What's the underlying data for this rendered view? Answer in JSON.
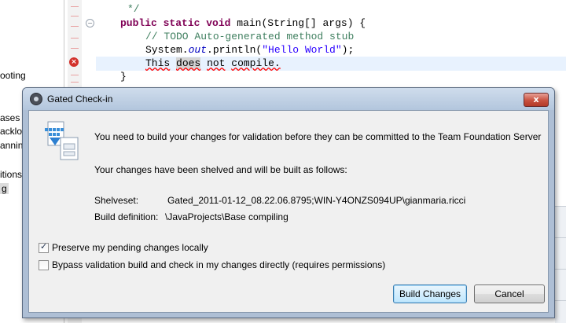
{
  "ide": {
    "left_panel": [
      "ooting",
      "ases",
      "acklog",
      "anning",
      "itions",
      "g"
    ],
    "code": {
      "line_comment_end": "*/",
      "main_kw1": "public",
      "main_kw2": "static",
      "main_kw3": "void",
      "main_rest": "main(String[] args) {",
      "todo_comment": "// TODO Auto-generated method stub",
      "println_prefix": "System.",
      "println_field": "out",
      "println_mid": ".println(",
      "println_string": "\"Hello World\"",
      "println_end": ");",
      "err_w1": "This",
      "err_w2": "does",
      "err_w3": "not",
      "err_w4": "compile.",
      "closing_brace": "}"
    }
  },
  "dialog": {
    "title": "Gated Check-in",
    "close_label": "x",
    "message_build": "You need to build your changes for validation before they can be committed to the Team Foundation Server",
    "message_shelved": "Your changes have been shelved and will be built as follows:",
    "shelveset_label": "Shelveset:",
    "shelveset_value": "Gated_2011-01-12_08.22.06.8795;WIN-Y4ONZS094UP\\gianmaria.ricci",
    "build_def_label": "Build definition:",
    "build_def_value": "\\JavaProjects\\Base compiling",
    "checkboxes": [
      {
        "label": "Preserve my pending changes locally",
        "checked": true
      },
      {
        "label": "Bypass validation build and check in my changes directly (requires permissions)",
        "checked": false
      }
    ],
    "buttons": {
      "build": "Build Changes",
      "cancel": "Cancel"
    }
  }
}
